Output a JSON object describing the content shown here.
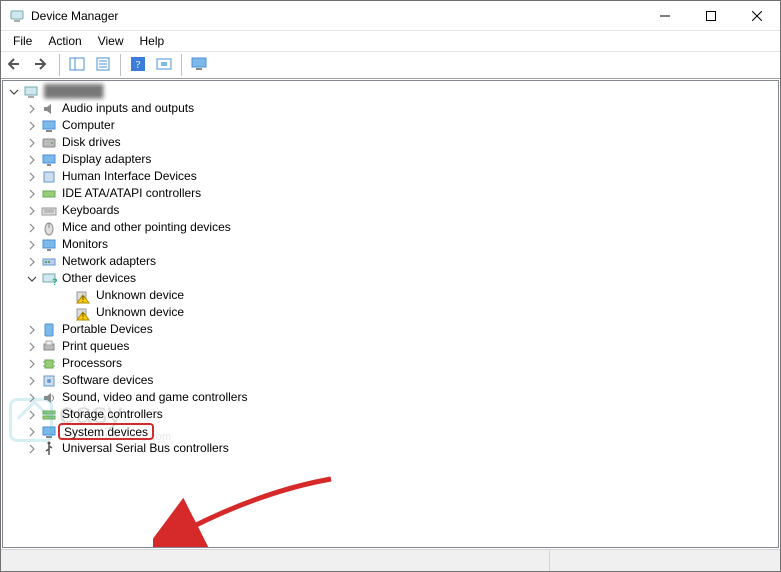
{
  "window": {
    "title": "Device Manager"
  },
  "menu": {
    "items": [
      "File",
      "Action",
      "View",
      "Help"
    ]
  },
  "toolbar": {
    "buttons": [
      {
        "name": "back-button",
        "icon": "arrow-left-icon"
      },
      {
        "name": "forward-button",
        "icon": "arrow-right-icon"
      },
      {
        "sep": true
      },
      {
        "name": "show-hidden-devices-button",
        "icon": "detail-pane-icon"
      },
      {
        "name": "properties-button",
        "icon": "properties-icon"
      },
      {
        "sep": true
      },
      {
        "name": "help-button",
        "icon": "help-icon"
      },
      {
        "name": "scan-hardware-button",
        "icon": "scan-icon"
      },
      {
        "sep": true
      },
      {
        "name": "view-devices-button",
        "icon": "monitor-icon"
      }
    ]
  },
  "tree": {
    "root": {
      "label": "███████",
      "icon": "computer-root-icon",
      "expanded": true,
      "children": [
        {
          "label": "Audio inputs and outputs",
          "icon": "audio-icon",
          "expanded": false
        },
        {
          "label": "Computer",
          "icon": "computer-icon",
          "expanded": false
        },
        {
          "label": "Disk drives",
          "icon": "disk-icon",
          "expanded": false
        },
        {
          "label": "Display adapters",
          "icon": "display-icon",
          "expanded": false
        },
        {
          "label": "Human Interface Devices",
          "icon": "hid-icon",
          "expanded": false
        },
        {
          "label": "IDE ATA/ATAPI controllers",
          "icon": "ide-icon",
          "expanded": false
        },
        {
          "label": "Keyboards",
          "icon": "keyboard-icon",
          "expanded": false
        },
        {
          "label": "Mice and other pointing devices",
          "icon": "mouse-icon",
          "expanded": false
        },
        {
          "label": "Monitors",
          "icon": "monitor-icon",
          "expanded": false
        },
        {
          "label": "Network adapters",
          "icon": "network-icon",
          "expanded": false
        },
        {
          "label": "Other devices",
          "icon": "other-icon",
          "expanded": true,
          "children": [
            {
              "label": "Unknown device",
              "icon": "warning-device-icon"
            },
            {
              "label": "Unknown device",
              "icon": "warning-device-icon"
            }
          ]
        },
        {
          "label": "Portable Devices",
          "icon": "portable-icon",
          "expanded": false
        },
        {
          "label": "Print queues",
          "icon": "printer-icon",
          "expanded": false
        },
        {
          "label": "Processors",
          "icon": "cpu-icon",
          "expanded": false
        },
        {
          "label": "Software devices",
          "icon": "software-icon",
          "expanded": false
        },
        {
          "label": "Sound, video and game controllers",
          "icon": "sound-icon",
          "expanded": false
        },
        {
          "label": "Storage controllers",
          "icon": "storage-icon",
          "expanded": false
        },
        {
          "label": "System devices",
          "icon": "system-icon",
          "expanded": false,
          "highlighted": true
        },
        {
          "label": "Universal Serial Bus controllers",
          "icon": "usb-icon",
          "expanded": false
        }
      ]
    }
  },
  "watermark": {
    "brand": "easy",
    "subtitle": "www.DriverEasy.com"
  },
  "annotation": {
    "type": "arrow",
    "color": "#d62a2a"
  }
}
